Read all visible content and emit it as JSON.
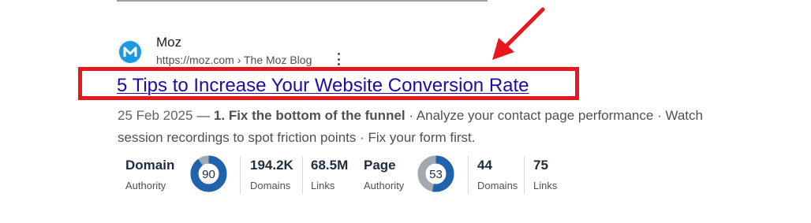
{
  "result": {
    "site_name": "Moz",
    "url_breadcrumb": "https://moz.com › The Moz Blog",
    "title": "5 Tips to Increase Your Website Conversion Rate",
    "snippet": {
      "date": "25 Feb 2025",
      "separator": " — ",
      "bold": "1. Fix the bottom of the funnel",
      "rest": " · Analyze your contact page performance · Watch session recordings to spot friction points · Fix your form first."
    }
  },
  "favicon": {
    "letter": "M",
    "color": "#1b9ae0"
  },
  "metrics": {
    "domain_authority": {
      "label_top": "Domain",
      "label_bottom": "Authority",
      "score": "90",
      "score_value": 90
    },
    "linking_domains_a": {
      "value": "194.2K",
      "label": "Domains"
    },
    "links_a": {
      "value": "68.5M",
      "label": "Links"
    },
    "page_authority": {
      "label_top": "Page",
      "label_bottom": "Authority",
      "score": "53",
      "score_value": 53
    },
    "linking_domains_b": {
      "value": "44",
      "label": "Domains"
    },
    "links_b": {
      "value": "75",
      "label": "Links"
    }
  },
  "colors": {
    "highlight": "#e8161d",
    "link": "#1a0dab",
    "gauge_fill": "#2162ad",
    "gauge_track": "#a3a9b0"
  }
}
